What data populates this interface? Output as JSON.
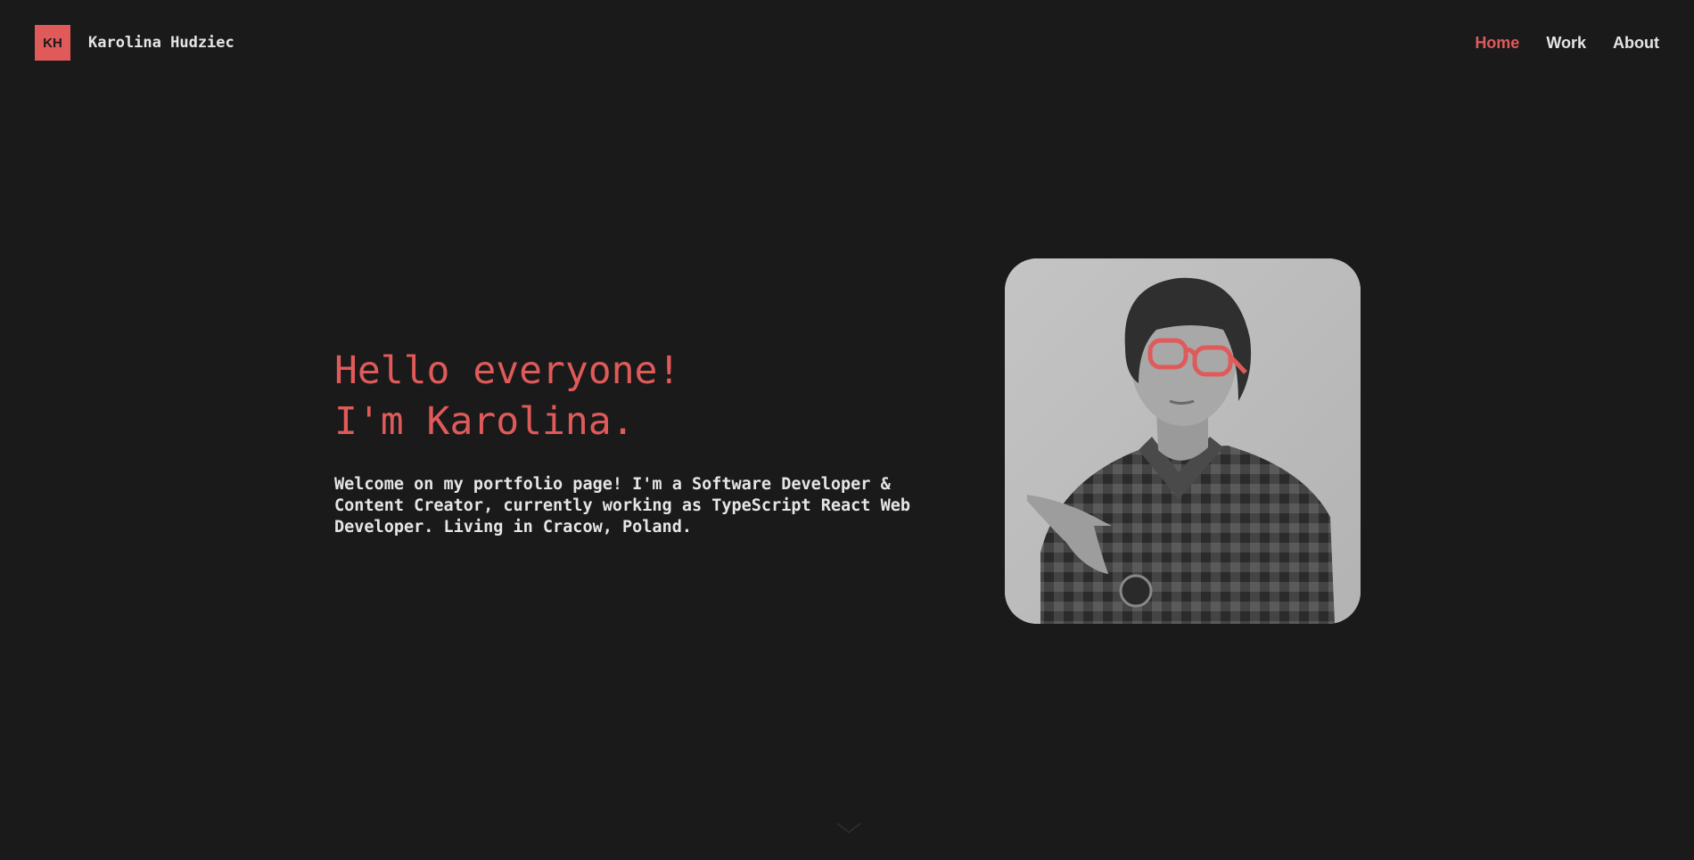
{
  "header": {
    "logo_initials": "KH",
    "site_name": "Karolina Hudziec"
  },
  "nav": {
    "items": [
      {
        "label": "Home",
        "active": true
      },
      {
        "label": "Work",
        "active": false
      },
      {
        "label": "About",
        "active": false
      }
    ]
  },
  "hero": {
    "headline_line1": "Hello everyone!",
    "headline_line2": "I'm Karolina.",
    "intro": "Welcome on my portfolio page! I'm a Software Developer & Content Creator, currently working as TypeScript React Web Developer. Living in Cracow, Poland."
  },
  "portrait": {
    "icon": "portrait-photo"
  },
  "scroll": {
    "icon": "chevron-down-icon"
  },
  "colors": {
    "background": "#1a1a1a",
    "accent": "#e05a5a",
    "text": "#e6e6e6"
  }
}
